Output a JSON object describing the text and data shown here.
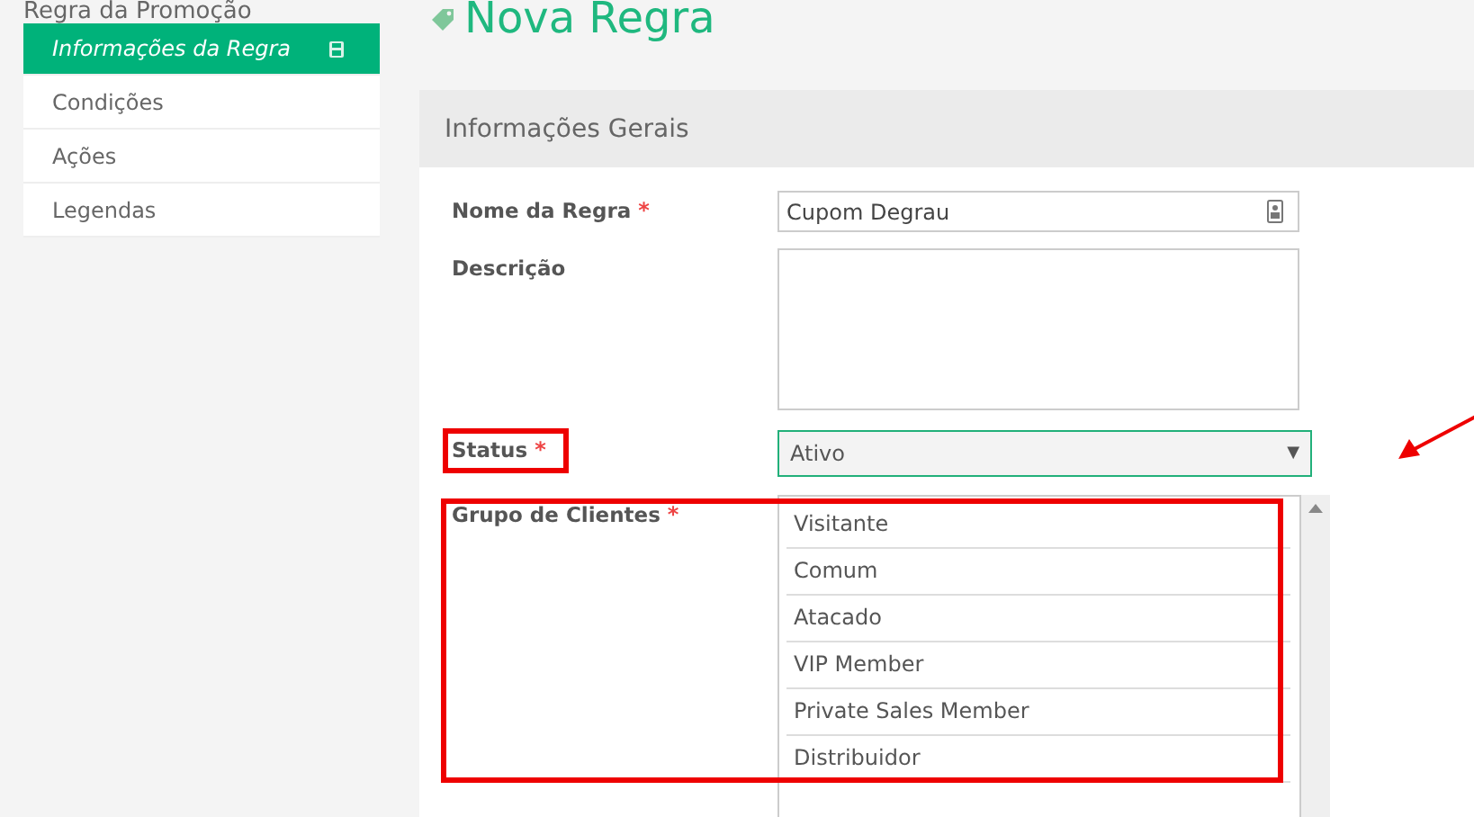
{
  "sidebar": {
    "heading": "Regra da Promoção",
    "items": [
      {
        "label": "Informações da Regra",
        "selected": true
      },
      {
        "label": "Condições",
        "selected": false
      },
      {
        "label": "Ações",
        "selected": false
      },
      {
        "label": "Legendas",
        "selected": false
      }
    ]
  },
  "page_title": "Nova Regra",
  "panel": {
    "title": "Informações Gerais",
    "fields": [
      {
        "kind": "text",
        "label": "Nome da Regra",
        "required_mark": "*",
        "value": "Cupom Degrau",
        "highlighted": false
      },
      {
        "kind": "textarea",
        "label": "Descrição",
        "highlighted": false
      },
      {
        "kind": "select",
        "label": "Status",
        "required_mark": "*",
        "value": "Ativo",
        "caret": "▼",
        "highlighted": true
      },
      {
        "kind": "multiselect",
        "label": "Grupo de Clientes",
        "required_mark": "*",
        "highlighted": true,
        "options": [
          {
            "label": "Visitante",
            "selected": false
          },
          {
            "label": "Comum",
            "selected": false
          },
          {
            "label": "Atacado",
            "selected": false
          },
          {
            "label": "VIP Member",
            "selected": false
          },
          {
            "label": "Private Sales Member",
            "selected": false
          },
          {
            "label": "Distribuidor",
            "selected": false
          }
        ]
      }
    ]
  }
}
